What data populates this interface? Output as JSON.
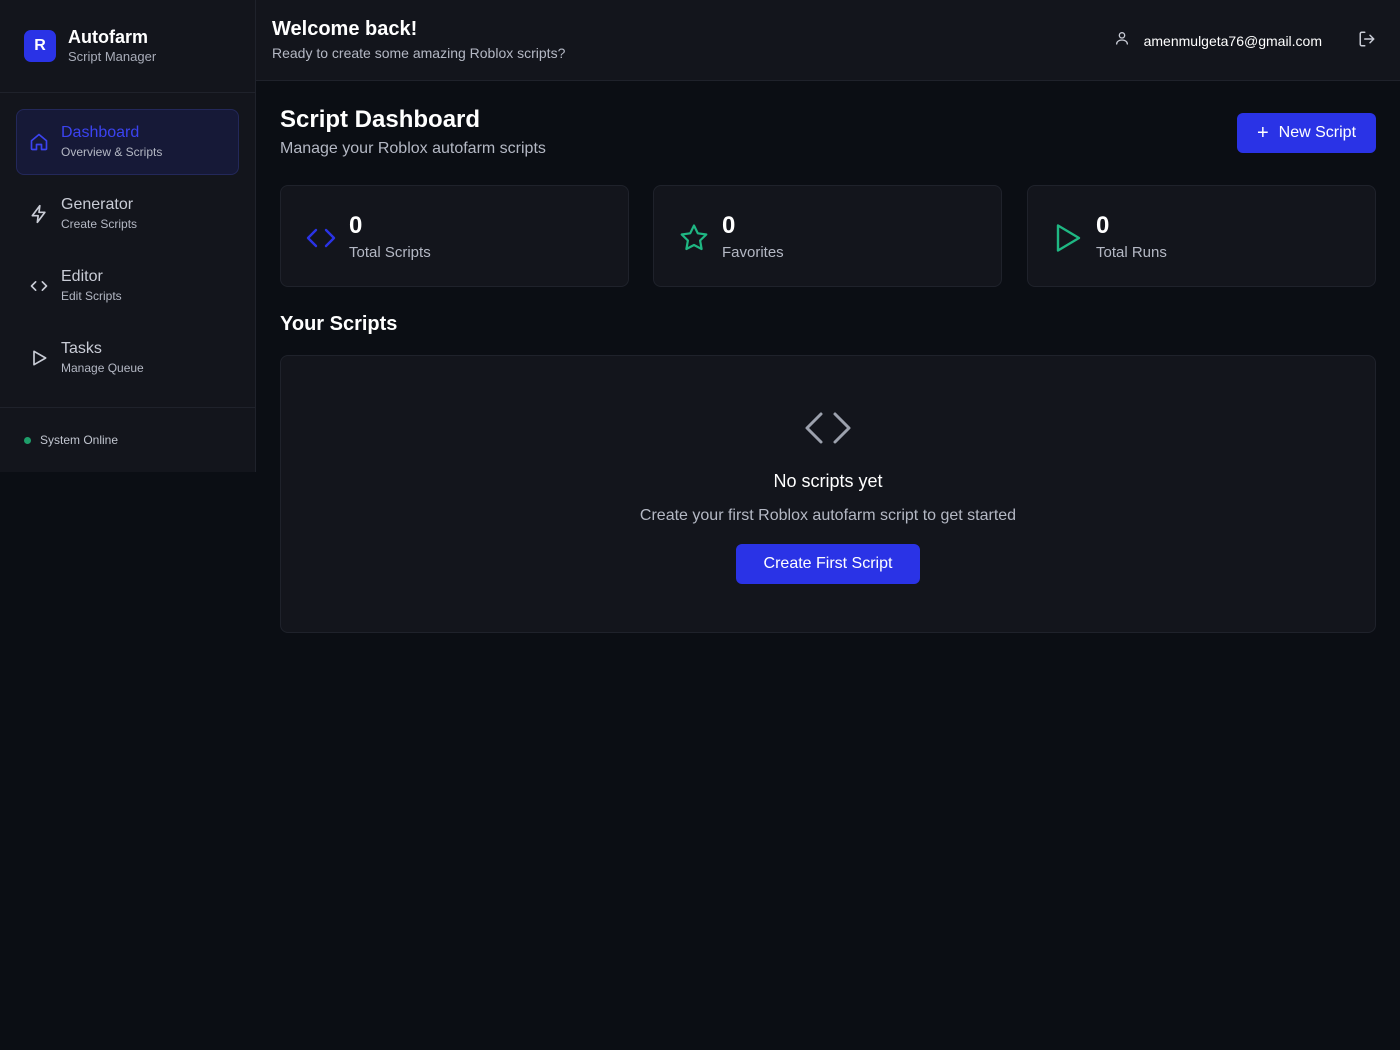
{
  "brand": {
    "logo_letter": "R",
    "name": "Autofarm",
    "subtitle": "Script Manager",
    "accent": "#2a33e6"
  },
  "sidebar": {
    "items": [
      {
        "label": "Dashboard",
        "sub": "Overview & Scripts",
        "icon": "home-icon",
        "active": true
      },
      {
        "label": "Generator",
        "sub": "Create Scripts",
        "icon": "lightning-icon",
        "active": false
      },
      {
        "label": "Editor",
        "sub": "Edit Scripts",
        "icon": "code-icon",
        "active": false
      },
      {
        "label": "Tasks",
        "sub": "Manage Queue",
        "icon": "play-icon",
        "active": false
      }
    ],
    "status": {
      "text": "System Online",
      "color": "#1e9e6a"
    }
  },
  "header": {
    "title": "Welcome back!",
    "subtitle": "Ready to create some amazing Roblox scripts?",
    "user_email": "amenmulgeta76@gmail.com",
    "user_icon": "user-icon",
    "logout_icon": "logout-icon"
  },
  "main": {
    "title": "Script Dashboard",
    "subtitle": "Manage your Roblox autofarm scripts",
    "new_button": {
      "icon": "+",
      "label": "New Script"
    },
    "stats": [
      {
        "value": "0",
        "label": "Total Scripts",
        "icon": "code-icon",
        "color": "#2a33e6"
      },
      {
        "value": "0",
        "label": "Favorites",
        "icon": "star-icon",
        "color": "#1fb783"
      },
      {
        "value": "0",
        "label": "Total Runs",
        "icon": "play-icon",
        "color": "#1fb783"
      }
    ],
    "section_title": "Your Scripts",
    "empty": {
      "icon": "code-icon",
      "title": "No scripts yet",
      "subtitle": "Create your first Roblox autofarm script to get started",
      "button_label": "Create First Script"
    }
  }
}
